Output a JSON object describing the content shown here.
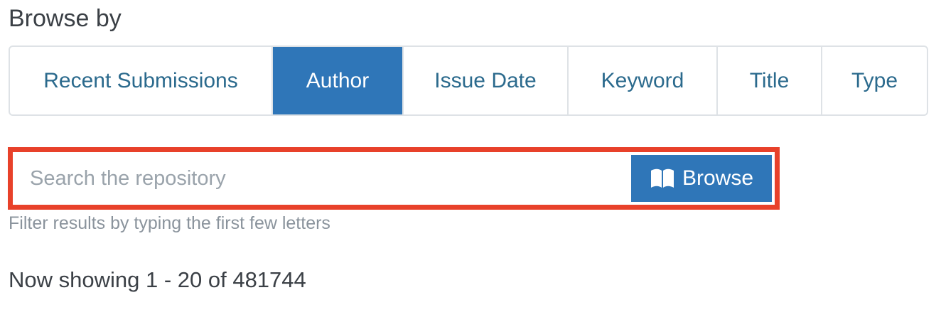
{
  "section": {
    "heading": "Browse by"
  },
  "tabs": [
    {
      "label": "Recent Submissions",
      "active": false
    },
    {
      "label": "Author",
      "active": true
    },
    {
      "label": "Issue Date",
      "active": false
    },
    {
      "label": "Keyword",
      "active": false
    },
    {
      "label": "Title",
      "active": false
    },
    {
      "label": "Type",
      "active": false
    }
  ],
  "search": {
    "placeholder": "Search the repository",
    "value": "",
    "button_label": "Browse",
    "button_icon": "book-icon",
    "hint": "Filter results by typing the first few letters",
    "highlight_color": "#e8412a"
  },
  "results": {
    "summary": "Now showing 1 - 20 of 481744"
  },
  "colors": {
    "accent": "#2f76b8",
    "tab_text": "#2b6a8d"
  }
}
